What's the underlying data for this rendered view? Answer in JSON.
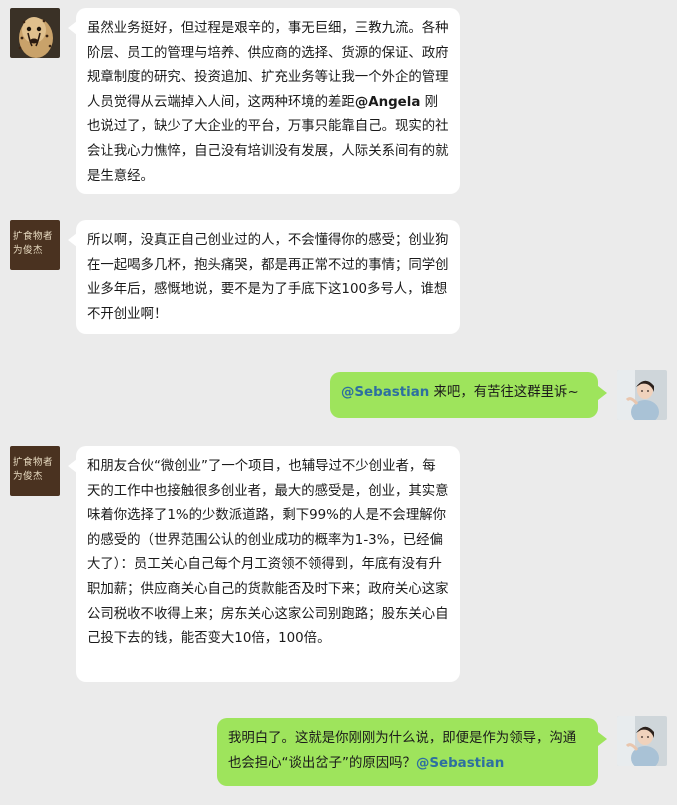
{
  "messages": [
    {
      "side": "left",
      "avatar": "cheetah-avatar",
      "before_mention": "虽然业务挺好，但过程是艰辛的，事无巨细，三教九流。各种阶层、员工的管理与培养、供应商的选择、货源的保证、政府规章制度的研究、投资追加、扩充业务等让我一个外企的管理人员觉得从云端掉入人间，这两种环境的差距",
      "mention": "@Angela",
      "after_mention": " 刚也说过了，缺少了大企业的平台，万事只能靠自己。现实的社会让我心力憔悴，自己没有培训没有发展，人际关系间有的就是生意经。"
    },
    {
      "side": "left",
      "avatar": "calligraphy-avatar",
      "avatar_text": "扩食物者为俊杰",
      "text": "所以啊，没真正自己创业过的人，不会懂得你的感受；创业狗在一起喝多几杯，抱头痛哭，都是再正常不过的事情；同学创业多年后，感慨地说，要不是为了手底下这100多号人，谁想不开创业啊！"
    },
    {
      "side": "right",
      "avatar": "person-avatar",
      "mention": "@Sebastian",
      "after_mention": " 来吧，有苦往这群里诉~"
    },
    {
      "side": "left",
      "avatar": "calligraphy-avatar",
      "avatar_text": "扩食物者为俊杰",
      "text": "和朋友合伙“微创业”了一个项目，也辅导过不少创业者，每天的工作中也接触很多创业者，最大的感受是，创业，其实意味着你选择了1%的少数派道路，剩下99%的人是不会理解你的感受的（世界范围公认的创业成功的概率为1-3%，已经偏大了）：员工关心自己每个月工资领不领得到，年底有没有升职加薪；供应商关心自己的货款能否及时下来；政府关心这家公司税收不收得上来；房东关心这家公司别跑路；股东关心自己投下去的钱，能否变大10倍，100倍。"
    },
    {
      "side": "right",
      "avatar": "person-avatar",
      "before_mention": "我明白了。这就是你刚刚为什么说，即便是作为领导，沟通也会担心“谈出岔子”的原因吗？",
      "mention": "@Sebastian"
    }
  ],
  "colors": {
    "background": "#ebebeb",
    "left_bubble": "#ffffff",
    "right_bubble": "#9ee45c",
    "mention": "#2d6fa0"
  }
}
